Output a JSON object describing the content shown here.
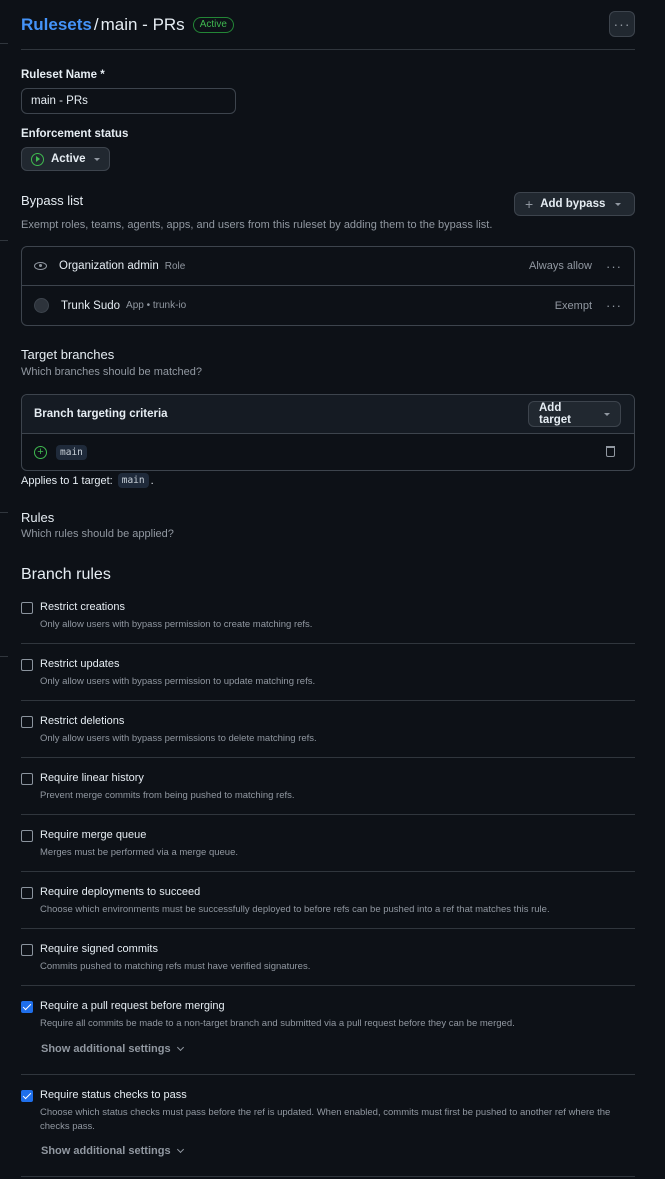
{
  "header": {
    "breadcrumb_link": "Rulesets",
    "separator": "/",
    "title": "main - PRs",
    "status_badge": "Active",
    "menu_icon": "kebab-horizontal-icon"
  },
  "form": {
    "name_label": "Ruleset Name *",
    "name_value": "main - PRs",
    "enforcement_label": "Enforcement status",
    "enforcement_value": "Active"
  },
  "bypass": {
    "title": "Bypass list",
    "subtitle": "Exempt roles, teams, agents, apps, and users from this ruleset by adding them to the bypass list.",
    "add_button": "Add bypass",
    "entries": [
      {
        "name": "Organization admin",
        "meta": "Role",
        "mode": "Always allow",
        "icon": "eye-icon"
      },
      {
        "name": "Trunk Sudo",
        "meta": "App • trunk-io",
        "mode": "Exempt",
        "icon": "app-avatar"
      }
    ]
  },
  "targets": {
    "title": "Target branches",
    "subtitle": "Which branches should be matched?",
    "criteria_header": "Branch targeting criteria",
    "add_button": "Add target",
    "branch": "main",
    "applies_prefix": "Applies to 1 target:",
    "applies_branch": "main",
    "applies_suffix": "."
  },
  "rules": {
    "title": "Rules",
    "subtitle": "Which rules should be applied?",
    "branch_rules_title": "Branch rules",
    "show_more": "Show additional settings",
    "items": [
      {
        "title": "Restrict creations",
        "desc": "Only allow users with bypass permission to create matching refs.",
        "checked": false
      },
      {
        "title": "Restrict updates",
        "desc": "Only allow users with bypass permission to update matching refs.",
        "checked": false
      },
      {
        "title": "Restrict deletions",
        "desc": "Only allow users with bypass permissions to delete matching refs.",
        "checked": false
      },
      {
        "title": "Require linear history",
        "desc": "Prevent merge commits from being pushed to matching refs.",
        "checked": false
      },
      {
        "title": "Require merge queue",
        "desc": "Merges must be performed via a merge queue.",
        "checked": false
      },
      {
        "title": "Require deployments to succeed",
        "desc": "Choose which environments must be successfully deployed to before refs can be pushed into a ref that matches this rule.",
        "checked": false
      },
      {
        "title": "Require signed commits",
        "desc": "Commits pushed to matching refs must have verified signatures.",
        "checked": false
      },
      {
        "title": "Require a pull request before merging",
        "desc": "Require all commits be made to a non-target branch and submitted via a pull request before they can be merged.",
        "checked": true
      },
      {
        "title": "Require status checks to pass",
        "desc": "Choose which status checks must pass before the ref is updated. When enabled, commits must first be pushed to another ref where the checks pass.",
        "checked": true
      }
    ]
  }
}
